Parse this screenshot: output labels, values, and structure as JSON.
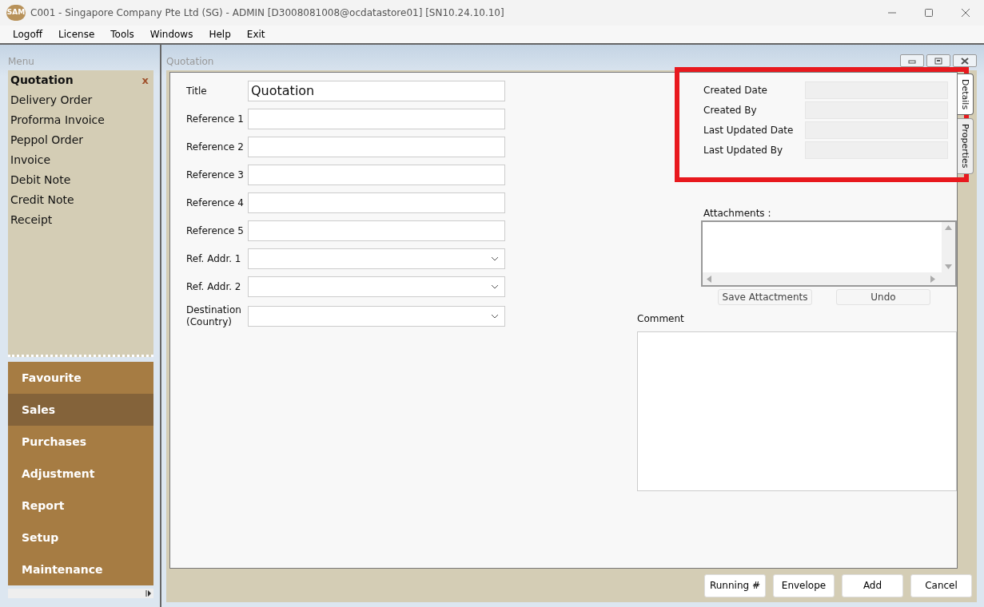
{
  "window": {
    "title": "C001 - Singapore Company Pte Ltd (SG) - ADMIN [D3008081008@ocdatastore01] [SN10.24.10.10]",
    "logo_text": "SAM"
  },
  "menu_bar": [
    "Logoff",
    "License",
    "Tools",
    "Windows",
    "Help",
    "Exit"
  ],
  "sidebar": {
    "title": "Menu",
    "items": [
      {
        "label": "Quotation",
        "selected": true,
        "close_label": "x"
      },
      {
        "label": "Delivery Order",
        "selected": false
      },
      {
        "label": "Proforma Invoice",
        "selected": false
      },
      {
        "label": "Peppol Order",
        "selected": false
      },
      {
        "label": "Invoice",
        "selected": false
      },
      {
        "label": "Debit Note",
        "selected": false
      },
      {
        "label": "Credit Note",
        "selected": false
      },
      {
        "label": "Receipt",
        "selected": false
      }
    ],
    "groups": [
      {
        "label": "Favourite",
        "selected": false
      },
      {
        "label": "Sales",
        "selected": true
      },
      {
        "label": "Purchases",
        "selected": false
      },
      {
        "label": "Adjustment",
        "selected": false
      },
      {
        "label": "Report",
        "selected": false
      },
      {
        "label": "Setup",
        "selected": false
      },
      {
        "label": "Maintenance",
        "selected": false
      }
    ]
  },
  "document": {
    "title": "Quotation",
    "fields": [
      {
        "label": "Title",
        "kind": "text",
        "value": "Quotation"
      },
      {
        "label": "Reference 1",
        "kind": "text"
      },
      {
        "label": "Reference 2",
        "kind": "text"
      },
      {
        "label": "Reference 3",
        "kind": "text"
      },
      {
        "label": "Reference 4",
        "kind": "text"
      },
      {
        "label": "Reference 5",
        "kind": "text"
      },
      {
        "label": "Ref. Addr. 1",
        "kind": "select"
      },
      {
        "label": "Ref. Addr. 2",
        "kind": "select"
      },
      {
        "label": "Destination (Country)",
        "kind": "select"
      }
    ],
    "properties": [
      {
        "label": "Created Date"
      },
      {
        "label": "Created By"
      },
      {
        "label": "Last Updated Date"
      },
      {
        "label": "Last Updated By"
      }
    ],
    "attachments": {
      "label": "Attachments :",
      "buttons": [
        "Save Attactments",
        "Undo"
      ]
    },
    "comment": {
      "label": "Comment"
    },
    "side_tabs": [
      {
        "label": "Details",
        "selected": true
      },
      {
        "label": "Properties",
        "selected": false
      }
    ],
    "footer_buttons": [
      "Running #",
      "Envelope",
      "Add",
      "Cancel"
    ]
  }
}
